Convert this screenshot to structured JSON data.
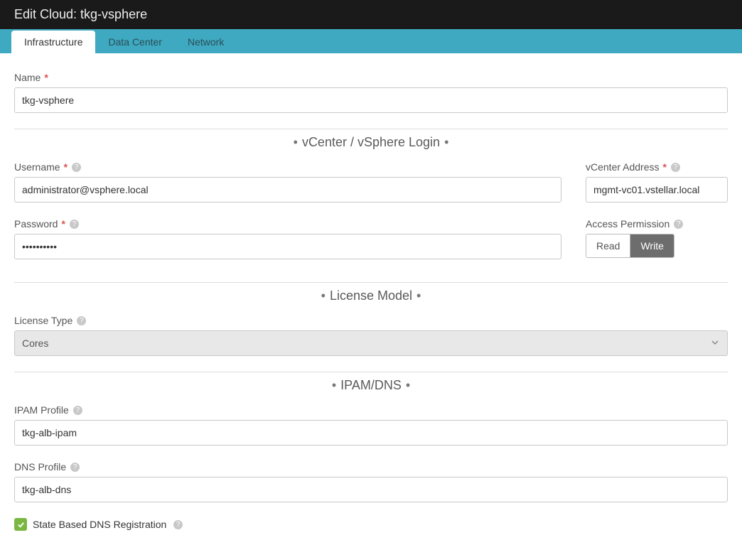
{
  "header": {
    "title": "Edit Cloud: tkg-vsphere"
  },
  "tabs": {
    "items": [
      {
        "label": "Infrastructure",
        "active": true
      },
      {
        "label": "Data Center",
        "active": false
      },
      {
        "label": "Network",
        "active": false
      }
    ]
  },
  "form": {
    "name": {
      "label": "Name",
      "value": "tkg-vsphere",
      "required": true
    },
    "sections": {
      "vcenter": {
        "title": "vCenter / vSphere Login",
        "username": {
          "label": "Username",
          "value": "administrator@vsphere.local",
          "required": true
        },
        "password": {
          "label": "Password",
          "value": "••••••••••",
          "required": true
        },
        "vcenter_address": {
          "label": "vCenter Address",
          "value": "mgmt-vc01.vstellar.local",
          "required": true
        },
        "access_permission": {
          "label": "Access Permission",
          "options": [
            "Read",
            "Write"
          ],
          "selected": "Write"
        }
      },
      "license": {
        "title": "License Model",
        "license_type": {
          "label": "License Type",
          "value": "Cores"
        }
      },
      "ipamdns": {
        "title": "IPAM/DNS",
        "ipam_profile": {
          "label": "IPAM Profile",
          "value": "tkg-alb-ipam"
        },
        "dns_profile": {
          "label": "DNS Profile",
          "value": "tkg-alb-dns"
        },
        "state_based_dns": {
          "label": "State Based DNS Registration",
          "checked": true
        }
      }
    }
  }
}
